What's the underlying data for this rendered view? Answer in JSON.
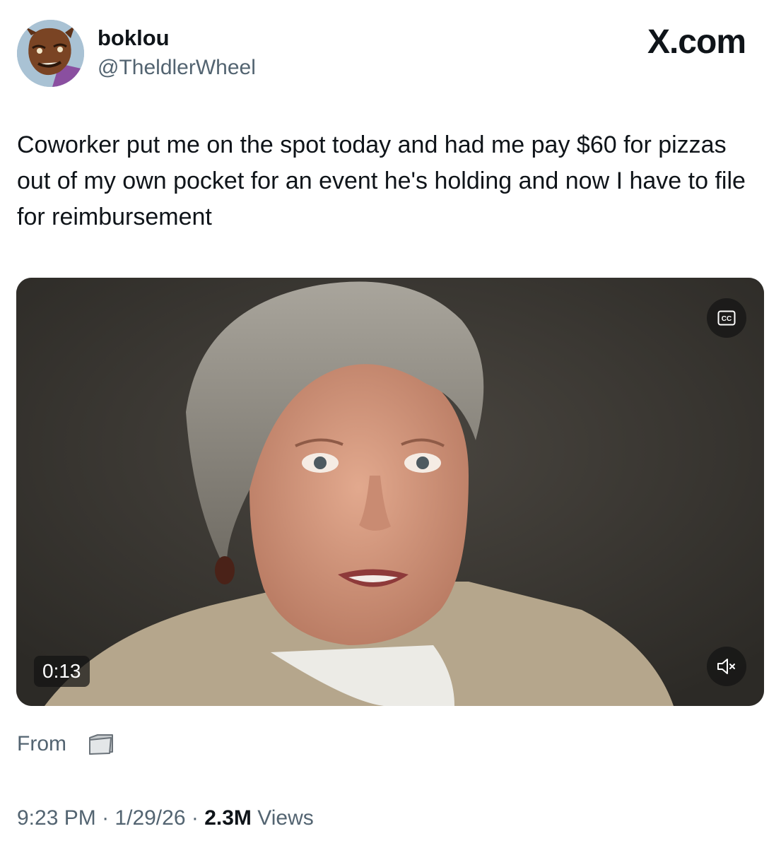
{
  "author": {
    "display_name": "boklou",
    "handle": "@TheldlerWheel",
    "avatar_icon": "cartoon-avatar-icon"
  },
  "brand": "X.com",
  "tweet": {
    "text": "Coworker put me on the spot today and had me pay $60 for pizzas out of my own pocket for an event he's holding and now I have to file for reimbursement"
  },
  "media": {
    "duration": "0:13",
    "cc_icon": "closed-captions-icon",
    "mute_icon": "volume-muted-icon"
  },
  "source": {
    "label": "From",
    "icon": "folder-icon"
  },
  "meta": {
    "time": "9:23 PM",
    "separator": "·",
    "date": "1/29/26",
    "views_count": "2.3M",
    "views_label": "Views"
  },
  "colors": {
    "text_primary": "#0f1419",
    "text_secondary": "#536471",
    "overlay": "#141414"
  }
}
